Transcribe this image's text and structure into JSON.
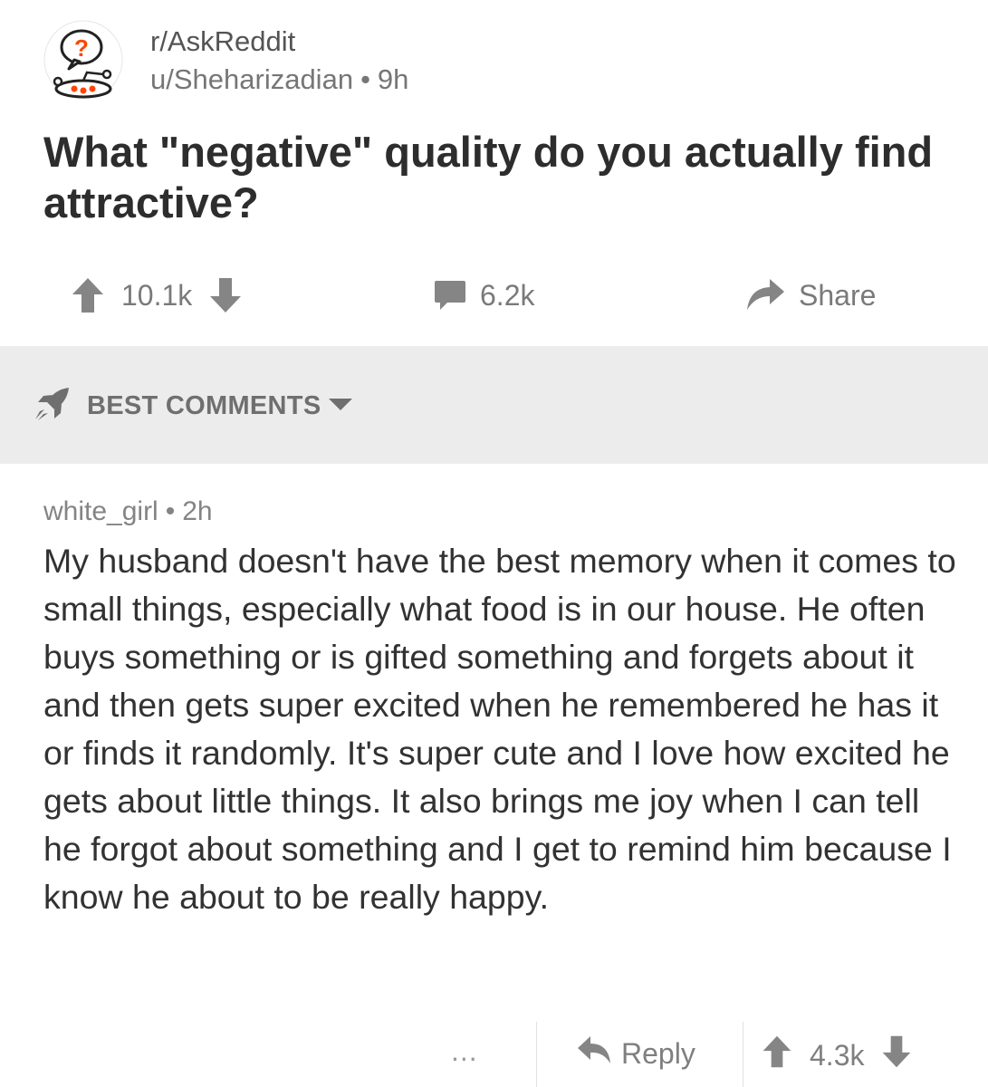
{
  "post": {
    "subreddit": "r/AskReddit",
    "author": "u/Sheharizadian",
    "separator": "•",
    "age": "9h",
    "title": "What \"negative\" quality do you actually find attractive?",
    "score": "10.1k",
    "comment_count": "6.2k",
    "share_label": "Share"
  },
  "sort": {
    "label": "BEST COMMENTS"
  },
  "comment": {
    "author": "white_girl",
    "separator": "•",
    "age": "2h",
    "body": "My husband doesn't have the best memory when it comes to small things, especially what food is in our house. He often buys something or is gifted something and forgets about it and then gets super excited when he remembered he has it or finds it randomly. It's super cute and I love how excited he gets about little things. It also brings me joy when I can tell he forgot about something and I get to remind him because I know he about to be really happy.",
    "more_label": "...",
    "reply_label": "Reply",
    "score": "4.3k"
  },
  "colors": {
    "icon_gray": "#858585",
    "sort_bar_bg": "#ececec",
    "snoo_red": "#ff4500"
  }
}
